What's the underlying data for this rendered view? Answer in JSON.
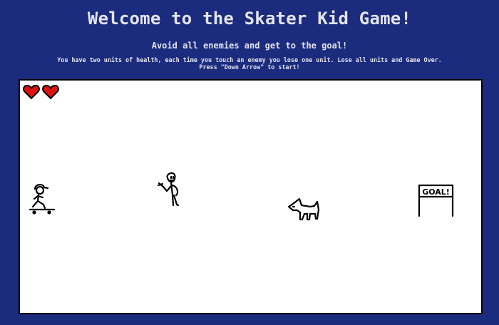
{
  "title": "Welcome to the Skater Kid Game!",
  "subtitle": "Avoid all enemies and get to the goal!",
  "instructions": {
    "line1": "You have two units of health, each time you touch an enemy you lose one unit. Lose all units and Game Over.",
    "line2": "Press \"Down Arrow\" to start!"
  },
  "game": {
    "health": 2,
    "goal_label": "GOAL!",
    "colors": {
      "background": "#1b2b7e",
      "canvas": "#ffffff",
      "heart": "#e01010"
    },
    "sprites": [
      "player-skater",
      "enemy-person",
      "enemy-dog",
      "goal-gate"
    ]
  }
}
